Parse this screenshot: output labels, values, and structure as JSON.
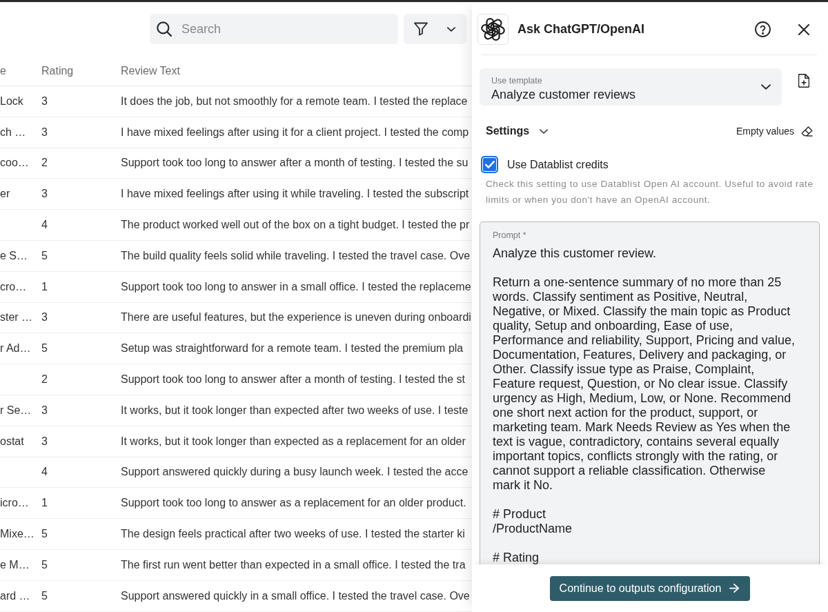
{
  "toolbar": {
    "search": {
      "placeholder": "Search"
    }
  },
  "table": {
    "columns": [
      "e",
      "Rating",
      "Review Text"
    ],
    "rows": [
      {
        "column_1": "Lock",
        "rating": "3",
        "review_text": "It does the job, but not smoothly for a remote team. I tested the replace"
      },
      {
        "column_1": "ch …",
        "rating": "3",
        "review_text": "I have mixed feelings after using it for a client project. I tested the comp"
      },
      {
        "column_1": "coo…",
        "rating": "2",
        "review_text": "Support took too long to answer after a month of testing. I tested the su"
      },
      {
        "column_1": "er",
        "rating": "3",
        "review_text": "I have mixed feelings after using it while traveling. I tested the subscript"
      },
      {
        "rating": "4",
        "review_text": "The product worked well out of the box on a tight budget. I tested the pr"
      },
      {
        "column_1": "e S…",
        "rating": "5",
        "review_text": "The build quality feels solid while traveling. I tested the travel case. Ove"
      },
      {
        "column_1": "cro…",
        "rating": "1",
        "review_text": "Support took too long to answer in a small office. I tested the replaceme"
      },
      {
        "column_1": "ster …",
        "rating": "3",
        "review_text": "There are useful features, but the experience is uneven during onboardi"
      },
      {
        "column_1": "r Ad…",
        "rating": "5",
        "review_text": "Setup was straightforward for a remote team. I tested the premium pla"
      },
      {
        "rating": "2",
        "review_text": "Support took too long to answer after a month of testing. I tested the st"
      },
      {
        "column_1": "r Se…",
        "rating": "3",
        "review_text": "It works, but it took longer than expected after two weeks of use. I teste"
      },
      {
        "column_1": "ostat",
        "rating": "3",
        "review_text": "It works, but it took longer than expected as a replacement for an older"
      },
      {
        "rating": "4",
        "review_text": "Support answered quickly during a busy launch week. I tested the acce"
      },
      {
        "column_1": "icro…",
        "rating": "1",
        "review_text": "Support took too long to answer as a replacement for an older product."
      },
      {
        "column_1": "Mixe…",
        "rating": "5",
        "review_text": "The design feels practical after two weeks of use. I tested the starter ki"
      },
      {
        "column_1": "e M…",
        "rating": "5",
        "review_text": "The first run went better than expected in a small office. I tested the tra"
      },
      {
        "column_1": "ard …",
        "rating": "5",
        "review_text": "Support answered quickly in a small office. I tested the travel case. Ove"
      }
    ]
  },
  "panel": {
    "title": "Ask ChatGPT/OpenAI",
    "template": {
      "label": "Use template",
      "value": "Analyze customer reviews"
    },
    "settings": {
      "label": "Settings",
      "empty_values": "Empty values"
    },
    "credits": {
      "label": "Use Datablist credits",
      "checked": true,
      "help": "Check this setting to use Datablist Open AI account. Useful to avoid rate limits or when you don't have an OpenAI account."
    },
    "prompt": {
      "label": "Prompt *",
      "value": "Analyze this customer review.\n\nReturn a one-sentence summary of no more than 25 words. Classify sentiment as Positive, Neutral, Negative, or Mixed. Classify the main topic as Product quality, Setup and onboarding, Ease of use, Performance and reliability, Support, Pricing and value, Documentation, Features, Delivery and packaging, or Other. Classify issue type as Praise, Complaint, Feature request, Question, or No clear issue. Classify urgency as High, Medium, Low, or None. Recommend one short next action for the product, support, or marketing team. Mark Needs Review as Yes when the text is vague, contradictory, contains several equally important topics, conflicts strongly with the rating, or cannot support a reliable classification. Otherwise mark it No.\n\n# Product\n/ProductName\n\n# Rating"
    },
    "continue_button": "Continue to outputs configuration"
  }
}
